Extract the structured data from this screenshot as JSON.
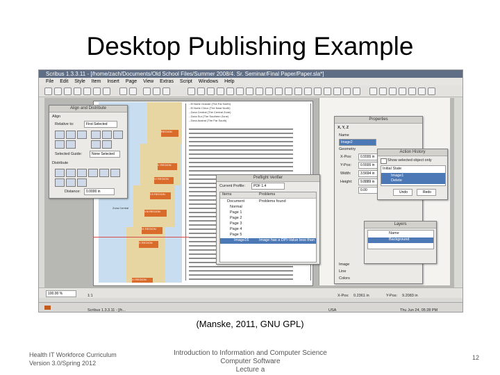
{
  "slide": {
    "title": "Desktop Publishing Example",
    "credit": "(Manske, 2011, GNU GPL)",
    "footer_left_line1": "Health IT Workforce Curriculum",
    "footer_left_line2": "Version 3.0/Spring 2012",
    "footer_center_line1": "Introduction to Information and Computer Science",
    "footer_center_line2": "Computer Software",
    "footer_center_line3": "Lecture a",
    "page_number": "12"
  },
  "app": {
    "window_title": "Scribus 1.3.3.11 - [/home/zach/Documents/Old School Files/Summer 2008/4. Sr. Seminar/Final Paper/Paper.sla*]",
    "menus": [
      "File",
      "Edit",
      "Style",
      "Item",
      "Insert",
      "Page",
      "View",
      "Extras",
      "Script",
      "Windows",
      "Help"
    ],
    "align_palette": {
      "title": "Align and Distribute",
      "align_section": "Align",
      "relative_to_label": "Relative to:",
      "relative_to_value": "First Selected",
      "selected_guide_label": "Selected Guide:",
      "selected_guide_value": "None Selected",
      "distribute_section": "Distribute",
      "distance_label": "Distance:",
      "distance_value": "0.0000 in"
    },
    "properties_palette": {
      "title": "Properties",
      "tab": "X, Y, Z",
      "name_label": "Name",
      "name_value": "Image2",
      "geometry_label": "Geometry",
      "x_label": "X-Pos:",
      "x_value": "0.5555 in",
      "y_label": "Y-Pos:",
      "y_value": "0.5555 in",
      "width_label": "Width:",
      "width_value": "3.5694 in",
      "height_label": "Height:",
      "height_value": "9.8889 in",
      "rotation_value": "0.00",
      "image_label": "Image",
      "line_label": "Line",
      "colors_label": "Colors"
    },
    "action_history": {
      "title": "Action History",
      "checkbox_label": "Show selected object only",
      "initial_state": "Initial State",
      "item_line1": "Image1",
      "item_line2": "Delete",
      "undo_button": "Undo",
      "redo_button": "Redo"
    },
    "preflight": {
      "title": "Preflight Verifier",
      "current_profile_label": "Current Profile:",
      "current_profile_value": "PDF 1.4",
      "col_items": "Items",
      "col_problems": "Problems",
      "rows": [
        {
          "item": "Document",
          "problem": "Problems found"
        },
        {
          "item": "Normal",
          "problem": ""
        },
        {
          "item": "Page 1",
          "problem": ""
        },
        {
          "item": "Page 2",
          "problem": ""
        },
        {
          "item": "Page 3",
          "problem": ""
        },
        {
          "item": "Page 4",
          "problem": ""
        },
        {
          "item": "Page 5",
          "problem": ""
        },
        {
          "item": "Image16",
          "problem": "Image has a DPI-Value less than"
        }
      ]
    },
    "layers": {
      "title": "Layers",
      "col_name": "Name",
      "row_name": "Background"
    },
    "map_labels": [
      "REGION",
      "V REGION",
      "VI REGION",
      "VII REGION",
      "VIII REGION",
      "IX REGION",
      "X REGION",
      "Zona Central",
      "XI REGION"
    ],
    "page_text_lines": [
      "- El Norte Grande (The Far North)",
      "- El Norte Chico (The Near North)",
      "- Zona Central (The Central Zone)",
      "- Zona Sur (The Southern Zone)",
      "- Zona Austral (The Far South)"
    ],
    "statusbar": {
      "zoom": "100.00 %",
      "page": "1:1",
      "x_label": "X-Pos:",
      "x_value": "0.2361 in",
      "y_label": "Y-Pos:",
      "y_value": "9.2083 in"
    },
    "taskbar": {
      "task": "Scribus 1.3.3.11 - [/h...",
      "locale": "USA",
      "clock": "Thu Jun 24, 05:28 PM"
    }
  }
}
